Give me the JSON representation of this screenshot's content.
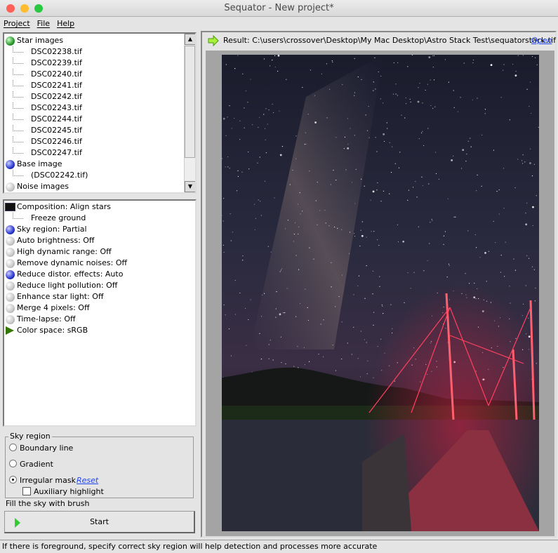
{
  "window": {
    "title": "Sequator - New project*"
  },
  "menu": [
    "Project",
    "File",
    "Help"
  ],
  "images_tree": {
    "star_label": "Star images",
    "star_files": [
      "DSC02238.tif",
      "DSC02239.tif",
      "DSC02240.tif",
      "DSC02241.tif",
      "DSC02242.tif",
      "DSC02243.tif",
      "DSC02244.tif",
      "DSC02245.tif",
      "DSC02246.tif",
      "DSC02247.tif"
    ],
    "base_label": "Base image",
    "base_file": "(DSC02242.tif)",
    "noise_label": "Noise images"
  },
  "settings": {
    "composition": "Composition: Align stars",
    "freeze": "Freeze ground",
    "items": [
      {
        "label": "Sky region: Partial",
        "state": "blue"
      },
      {
        "label": "Auto brightness: Off",
        "state": "grey"
      },
      {
        "label": "High dynamic range: Off",
        "state": "grey"
      },
      {
        "label": "Remove dynamic noises: Off",
        "state": "grey"
      },
      {
        "label": "Reduce distor. effects: Auto",
        "state": "blue"
      },
      {
        "label": "Reduce light pollution: Off",
        "state": "grey"
      },
      {
        "label": "Enhance star light: Off",
        "state": "grey"
      },
      {
        "label": "Merge 4 pixels: Off",
        "state": "grey"
      },
      {
        "label": "Time-lapse: Off",
        "state": "grey"
      }
    ],
    "color_space": "Color space: sRGB"
  },
  "sky_region": {
    "title": "Sky region",
    "boundary": "Boundary line",
    "gradient": "Gradient",
    "irregular": "Irregular mask",
    "reset": "Reset",
    "aux": "Auxiliary highlight",
    "selected": "Irregular mask",
    "aux_checked": false
  },
  "hint": "Fill the sky with brush",
  "start_label": "Start",
  "result": {
    "text": "Result: C:\\users\\crossover\\Desktop\\My Mac Desktop\\Astro Stack Test\\sequatorstack.tif",
    "open": "Open"
  },
  "status": "If there is foreground, specify correct sky region will help detection and processes more accurate"
}
